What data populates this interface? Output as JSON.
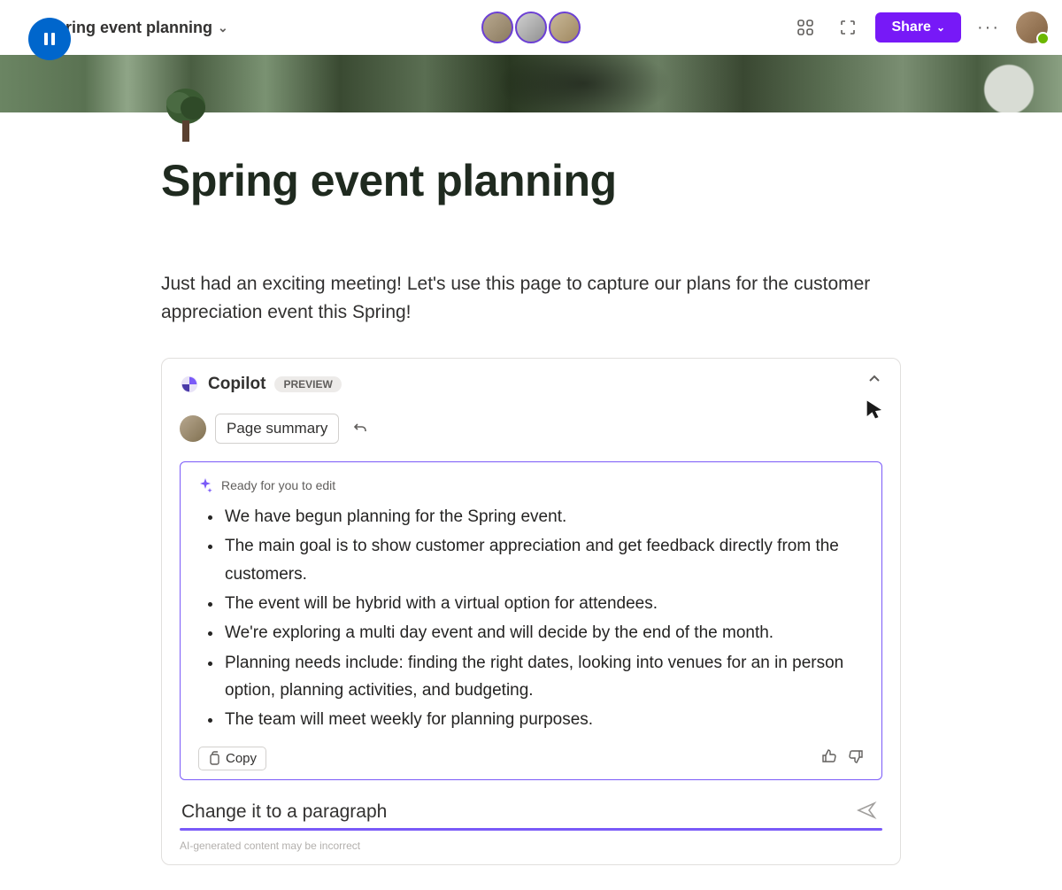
{
  "header": {
    "breadcrumb": "ring event planning",
    "share_label": "Share"
  },
  "page": {
    "title": "Spring event planning",
    "intro": "Just had an exciting meeting! Let's use this page to capture our plans for the customer appreciation event this Spring!"
  },
  "copilot": {
    "title": "Copilot",
    "badge": "PREVIEW",
    "prompt_chip": "Page summary",
    "ready_text": "Ready for you to edit",
    "bullets": [
      "We have begun planning for the Spring event.",
      "The main goal is to show customer appreciation and get feedback directly from the customers.",
      "The event will be hybrid with a virtual option for attendees.",
      "We're exploring a multi day event and will decide by the end of the month.",
      "Planning needs include: finding the right dates, looking into venues for an in person option, planning activities, and budgeting.",
      "The team will meet weekly for planning purposes."
    ],
    "copy_label": "Copy",
    "input_value": "Change it to a paragraph",
    "disclaimer": "AI-generated content may be incorrect"
  }
}
